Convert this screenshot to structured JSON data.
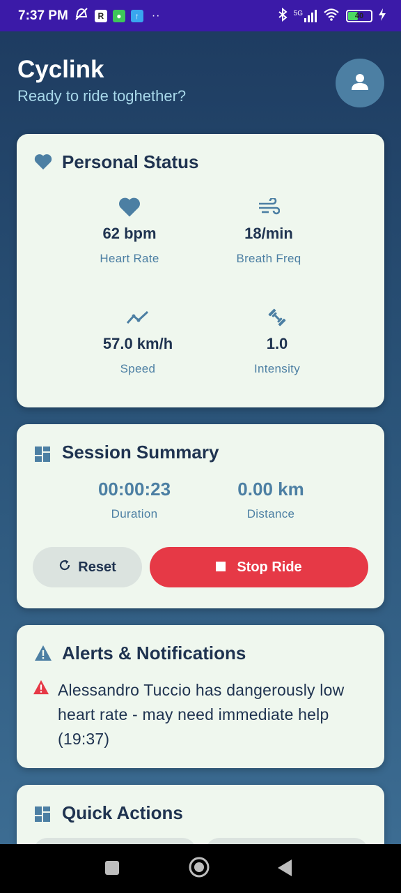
{
  "status_bar": {
    "time": "7:37 PM",
    "app_badge_r": "R",
    "dots": "··",
    "network": "5G",
    "battery": "40"
  },
  "header": {
    "title": "Cyclink",
    "subtitle": "Ready to ride toghether?"
  },
  "personal_status": {
    "title": "Personal Status",
    "metrics": [
      {
        "value": "62 bpm",
        "label": "Heart Rate",
        "icon": "heart-icon"
      },
      {
        "value": "18/min",
        "label": "Breath Freq",
        "icon": "wind-icon"
      },
      {
        "value": "57.0 km/h",
        "label": "Speed",
        "icon": "trend-icon"
      },
      {
        "value": "1.0",
        "label": "Intensity",
        "icon": "dumbbell-icon"
      }
    ]
  },
  "session_summary": {
    "title": "Session Summary",
    "duration_value": "00:00:23",
    "duration_label": "Duration",
    "distance_value": "0.00 km",
    "distance_label": "Distance",
    "reset_label": "Reset",
    "stop_label": "Stop Ride"
  },
  "alerts": {
    "title": "Alerts & Notifications",
    "message": "Alessandro Tuccio has dangerously low heart rate - may need immediate help (19:37)"
  },
  "quick_actions": {
    "title": "Quick Actions"
  },
  "colors": {
    "accent": "#4c7fa3",
    "danger": "#e63946",
    "card": "#eff7ee",
    "status_bar": "#3b1aa8"
  }
}
